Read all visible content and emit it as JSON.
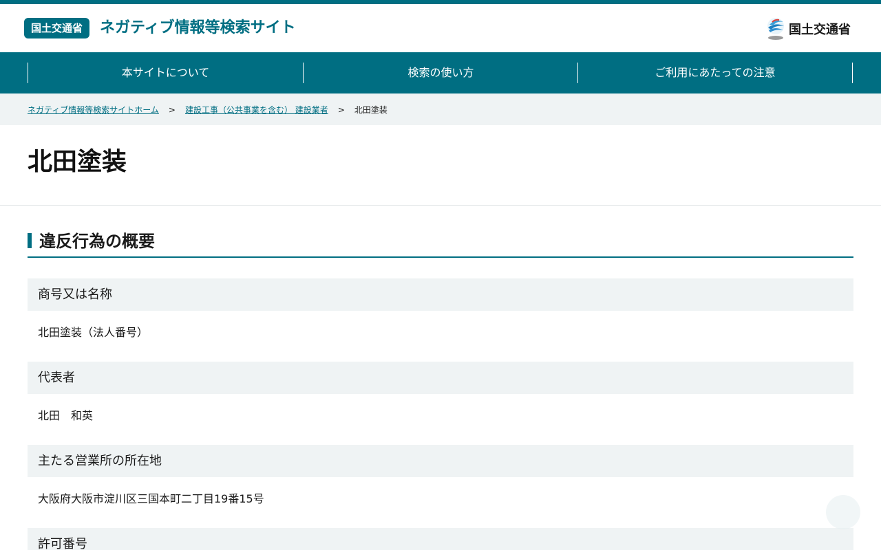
{
  "header": {
    "badge": "国土交通省",
    "site_title": "ネガティブ情報等検索サイト",
    "ministry_name": "国土交通省"
  },
  "nav": {
    "items": [
      {
        "label": "本サイトについて"
      },
      {
        "label": "検索の使い方"
      },
      {
        "label": "ご利用にあたっての注意"
      }
    ]
  },
  "breadcrumb": {
    "home": "ネガティブ情報等検索サイトホーム",
    "separator": ">",
    "category": "建設工事（公共事業を含む） 建設業者",
    "current": "北田塗装"
  },
  "page": {
    "title": "北田塗装"
  },
  "section": {
    "title": "違反行為の概要"
  },
  "fields": [
    {
      "label": "商号又は名称",
      "value": "北田塗装（法人番号）"
    },
    {
      "label": "代表者",
      "value": "北田　和英"
    },
    {
      "label": "主たる営業所の所在地",
      "value": "大阪府大阪市淀川区三国本町二丁目19番15号"
    },
    {
      "label": "許可番号",
      "value": ""
    }
  ],
  "colors": {
    "brand": "#006e82",
    "label_bg": "#eff3f4"
  }
}
